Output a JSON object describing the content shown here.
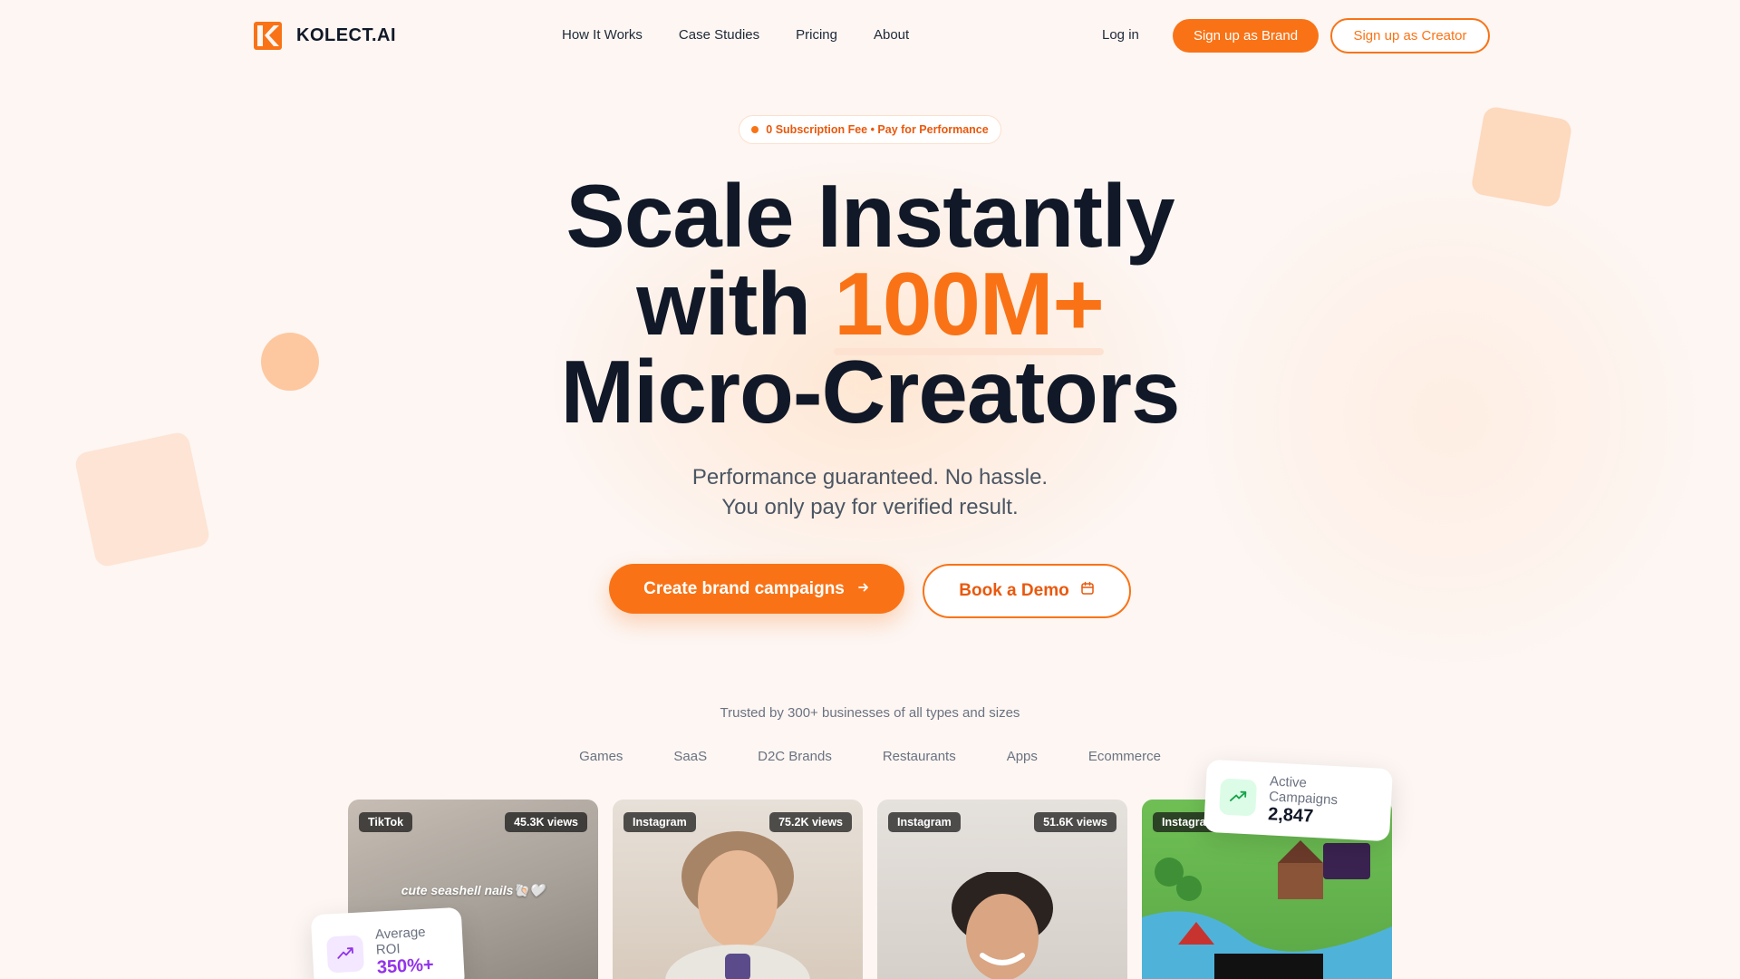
{
  "brand": {
    "name": "KOLECT.AI",
    "accent": "#f97316"
  },
  "nav": {
    "links": [
      "How It Works",
      "Case Studies",
      "Pricing",
      "About"
    ],
    "login": "Log in",
    "brand_signup": "Sign up as Brand",
    "creator_signup": "Sign up as Creator"
  },
  "hero": {
    "pill": "0 Subscription Fee • Pay for Performance",
    "headline_line1": "Scale Instantly",
    "headline_line2_prefix": "with ",
    "headline_accent": "100M+",
    "headline_line3": "Micro-Creators",
    "sub_line1": "Performance guaranteed. No hassle.",
    "sub_line2": "You only pay for verified result.",
    "cta_primary": "Create brand campaigns",
    "cta_secondary": "Book a Demo"
  },
  "trusted": {
    "text": "Trusted by 300+ businesses of all types and sizes",
    "categories": [
      "Games",
      "SaaS",
      "D2C Brands",
      "Restaurants",
      "Apps",
      "Ecommerce"
    ]
  },
  "cards": [
    {
      "platform": "TikTok",
      "views": "45.3K views",
      "caption": "cute seashell nails🐚🤍"
    },
    {
      "platform": "Instagram",
      "views": "75.2K views"
    },
    {
      "platform": "Instagram",
      "views": "51.6K views"
    },
    {
      "platform": "Instagram"
    }
  ],
  "stats": {
    "roi_label": "Average ROI",
    "roi_value": "350%+",
    "active_label": "Active Campaigns",
    "active_value": "2,847"
  },
  "icons": [
    "logo-k-icon",
    "arrow-right-icon",
    "calendar-icon",
    "trending-up-icon"
  ]
}
